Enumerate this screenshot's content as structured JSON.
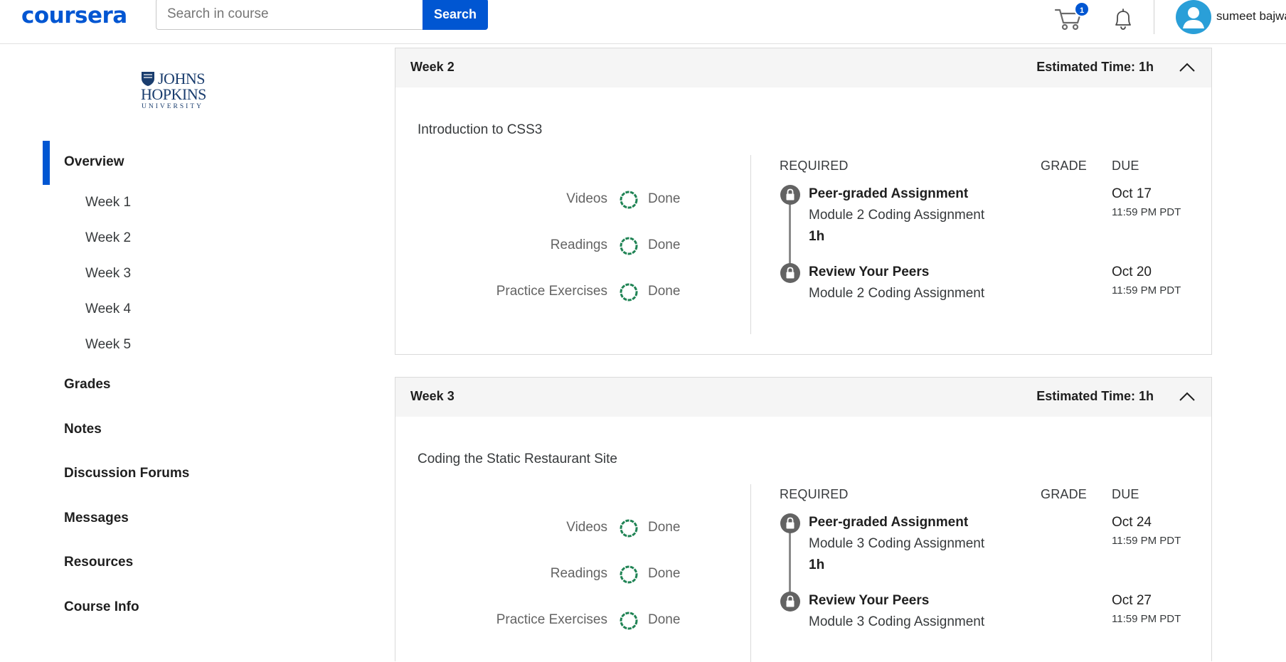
{
  "header": {
    "logo": "coursera",
    "search_placeholder": "Search in course",
    "search_button": "Search",
    "cart_count": "1",
    "username": "sumeet bajwa",
    "brand_color": "#0056d2"
  },
  "sidebar": {
    "university": {
      "line1": "JOHNS",
      "line2": "HOPKINS",
      "line3": "UNIVERSITY"
    },
    "overview": "Overview",
    "weeks": [
      "Week 1",
      "Week 2",
      "Week 3",
      "Week 4",
      "Week 5"
    ],
    "items": [
      "Grades",
      "Notes",
      "Discussion Forums",
      "Messages",
      "Resources",
      "Course Info"
    ]
  },
  "weeks": [
    {
      "title": "Week 2",
      "estimated_time": "Estimated Time: 1h",
      "subtitle": "Introduction to CSS3",
      "progress": [
        {
          "label": "Videos",
          "status": "Done"
        },
        {
          "label": "Readings",
          "status": "Done"
        },
        {
          "label": "Practice Exercises",
          "status": "Done"
        }
      ],
      "columns": {
        "required": "REQUIRED",
        "grade": "GRADE",
        "due": "DUE"
      },
      "assignments": [
        {
          "title": "Peer-graded Assignment",
          "subtitle": "Module 2 Coding Assignment",
          "duration": "1h",
          "due_date": "Oct 17",
          "due_time": "11:59 PM PDT"
        },
        {
          "title": "Review Your Peers",
          "subtitle": "Module 2 Coding Assignment",
          "duration": "",
          "due_date": "Oct 20",
          "due_time": "11:59 PM PDT"
        }
      ]
    },
    {
      "title": "Week 3",
      "estimated_time": "Estimated Time: 1h",
      "subtitle": "Coding the Static Restaurant Site",
      "progress": [
        {
          "label": "Videos",
          "status": "Done"
        },
        {
          "label": "Readings",
          "status": "Done"
        },
        {
          "label": "Practice Exercises",
          "status": "Done"
        }
      ],
      "columns": {
        "required": "REQUIRED",
        "grade": "GRADE",
        "due": "DUE"
      },
      "assignments": [
        {
          "title": "Peer-graded Assignment",
          "subtitle": "Module 3 Coding Assignment",
          "duration": "1h",
          "due_date": "Oct 24",
          "due_time": "11:59 PM PDT"
        },
        {
          "title": "Review Your Peers",
          "subtitle": "Module 3 Coding Assignment",
          "duration": "",
          "due_date": "Oct 27",
          "due_time": "11:59 PM PDT"
        }
      ]
    }
  ]
}
